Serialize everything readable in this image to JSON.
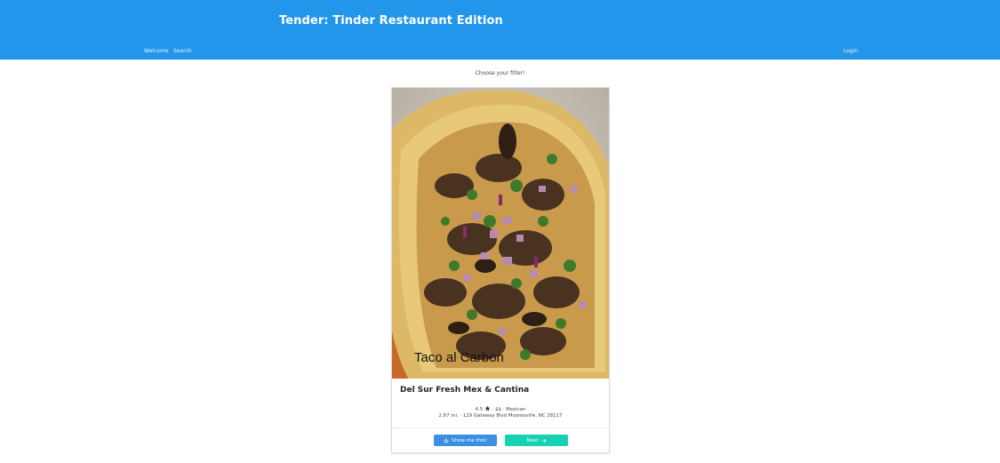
{
  "header": {
    "title": "Tender: Tinder Restaurant Edition",
    "nav": {
      "welcome": "Welcome",
      "search": "Search",
      "login": "Login"
    },
    "accent_color": "#2196ea"
  },
  "filter_prompt": "Choose your filter!",
  "restaurant": {
    "photo_caption": "Taco al Carbon",
    "name": "Del Sur Fresh Mex & Cantina",
    "rating": "4.5",
    "rating_icon": "star-icon",
    "price_and_category": "· $$ · Mexican",
    "distance_and_address": "2.87 mi. · 129 Gateway Blvd Mooresville, NC 28117"
  },
  "actions": {
    "show_me_label": "Show me this!",
    "show_me_icon": "star-outline-icon",
    "next_label": "Next",
    "next_icon": "arrow-right-icon",
    "show_color": "#3a8fe0",
    "next_color": "#17d1b3"
  }
}
